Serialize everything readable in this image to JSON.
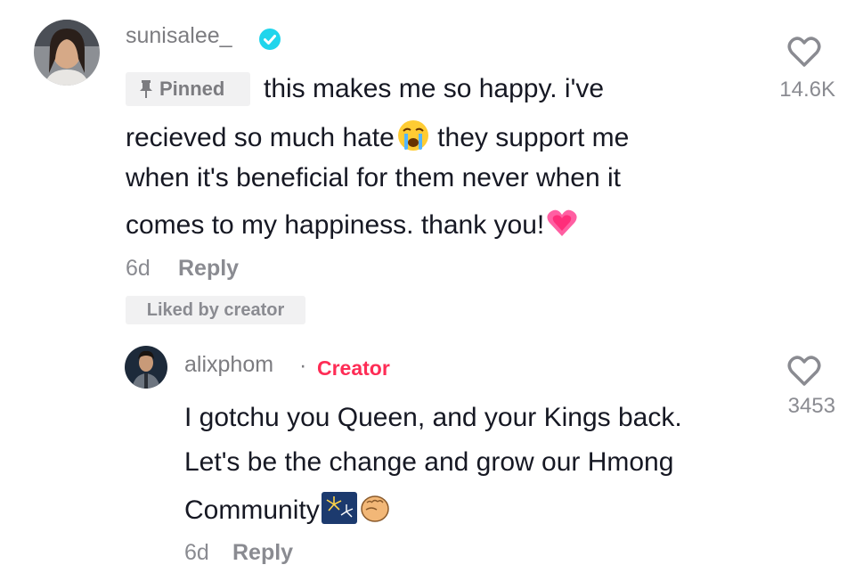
{
  "comments": [
    {
      "username": "sunisalee_",
      "verified": true,
      "pinned_label": "Pinned",
      "lines": [
        "this makes me so happy. i've",
        "recieved so much hate",
        " they support me",
        "when it's beneficial for them never when it",
        "comes to my happiness. thank you!"
      ],
      "time": "6d",
      "reply_label": "Reply",
      "liked_badge": "Liked by creator",
      "like_count": "14.6K",
      "emojis": [
        "loudly-crying-face",
        "growing-heart"
      ]
    },
    {
      "username": "alixphom",
      "separator": "·",
      "creator_badge": "Creator",
      "lines": [
        "I gotchu you Queen, and your Kings back.",
        "Let's be the change and grow our Hmong",
        "Community"
      ],
      "time": "6d",
      "reply_label": "Reply",
      "like_count": "3453",
      "emojis": [
        "fireworks",
        "oncoming-fist"
      ]
    }
  ],
  "colors": {
    "creator_accent": "#fe2c55",
    "verified_blue": "#20d5ec",
    "secondary_text": "#8a8b91",
    "badge_bg": "#f1f1f2"
  }
}
